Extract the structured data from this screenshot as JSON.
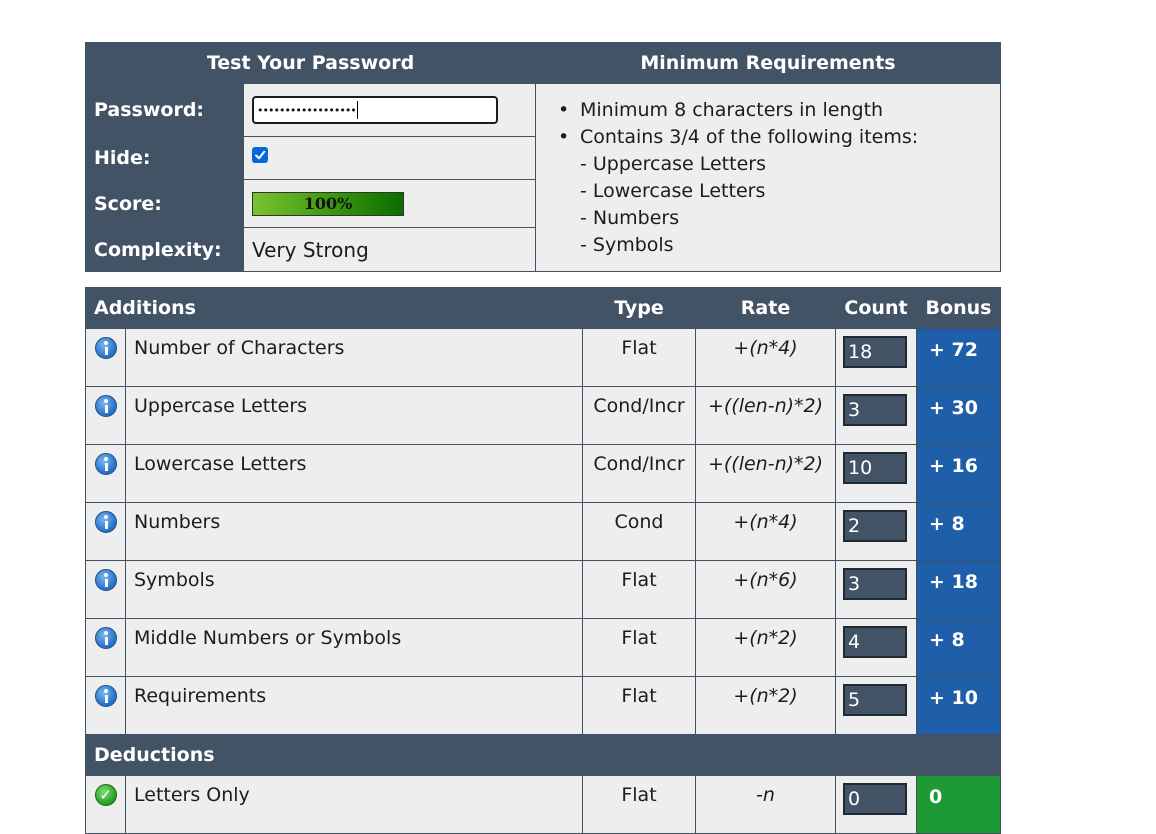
{
  "test_panel": {
    "title": "Test Your Password",
    "password_label": "Password:",
    "password_value": "••••••••••••••••••",
    "hide_label": "Hide:",
    "hide_checked": true,
    "score_label": "Score:",
    "score_text": "100%",
    "score_fraction": 1.0,
    "complexity_label": "Complexity:",
    "complexity_value": "Very Strong"
  },
  "requirements": {
    "title": "Minimum Requirements",
    "items": [
      "Minimum 8 characters in length",
      "Contains 3/4 of the following items:"
    ],
    "sub_items": [
      "- Uppercase Letters",
      "- Lowercase Letters",
      "- Numbers",
      "- Symbols"
    ]
  },
  "scoring": {
    "headers": {
      "additions": "Additions",
      "type": "Type",
      "rate": "Rate",
      "count": "Count",
      "bonus": "Bonus"
    },
    "additions": [
      {
        "name": "Number of Characters",
        "type": "Flat",
        "rate": "+(n*4)",
        "count": "18",
        "bonus": "+ 72",
        "icon": "info-icon"
      },
      {
        "name": "Uppercase Letters",
        "type": "Cond/Incr",
        "rate": "+((len-n)*2)",
        "count": "3",
        "bonus": "+ 30",
        "icon": "info-icon"
      },
      {
        "name": "Lowercase Letters",
        "type": "Cond/Incr",
        "rate": "+((len-n)*2)",
        "count": "10",
        "bonus": "+ 16",
        "icon": "info-icon"
      },
      {
        "name": "Numbers",
        "type": "Cond",
        "rate": "+(n*4)",
        "count": "2",
        "bonus": "+ 8",
        "icon": "info-icon"
      },
      {
        "name": "Symbols",
        "type": "Flat",
        "rate": "+(n*6)",
        "count": "3",
        "bonus": "+ 18",
        "icon": "info-icon"
      },
      {
        "name": "Middle Numbers or Symbols",
        "type": "Flat",
        "rate": "+(n*2)",
        "count": "4",
        "bonus": "+ 8",
        "icon": "info-icon"
      },
      {
        "name": "Requirements",
        "type": "Flat",
        "rate": "+(n*2)",
        "count": "5",
        "bonus": "+ 10",
        "icon": "info-icon"
      }
    ],
    "deductions_label": "Deductions",
    "deductions": [
      {
        "name": "Letters Only",
        "type": "Flat",
        "rate": "-n",
        "count": "0",
        "bonus": "0",
        "icon": "check-icon"
      }
    ],
    "colors": {
      "header_bg": "#435366",
      "bonus_blue": "#1f5ea8",
      "bonus_green": "#1e9a35"
    }
  }
}
